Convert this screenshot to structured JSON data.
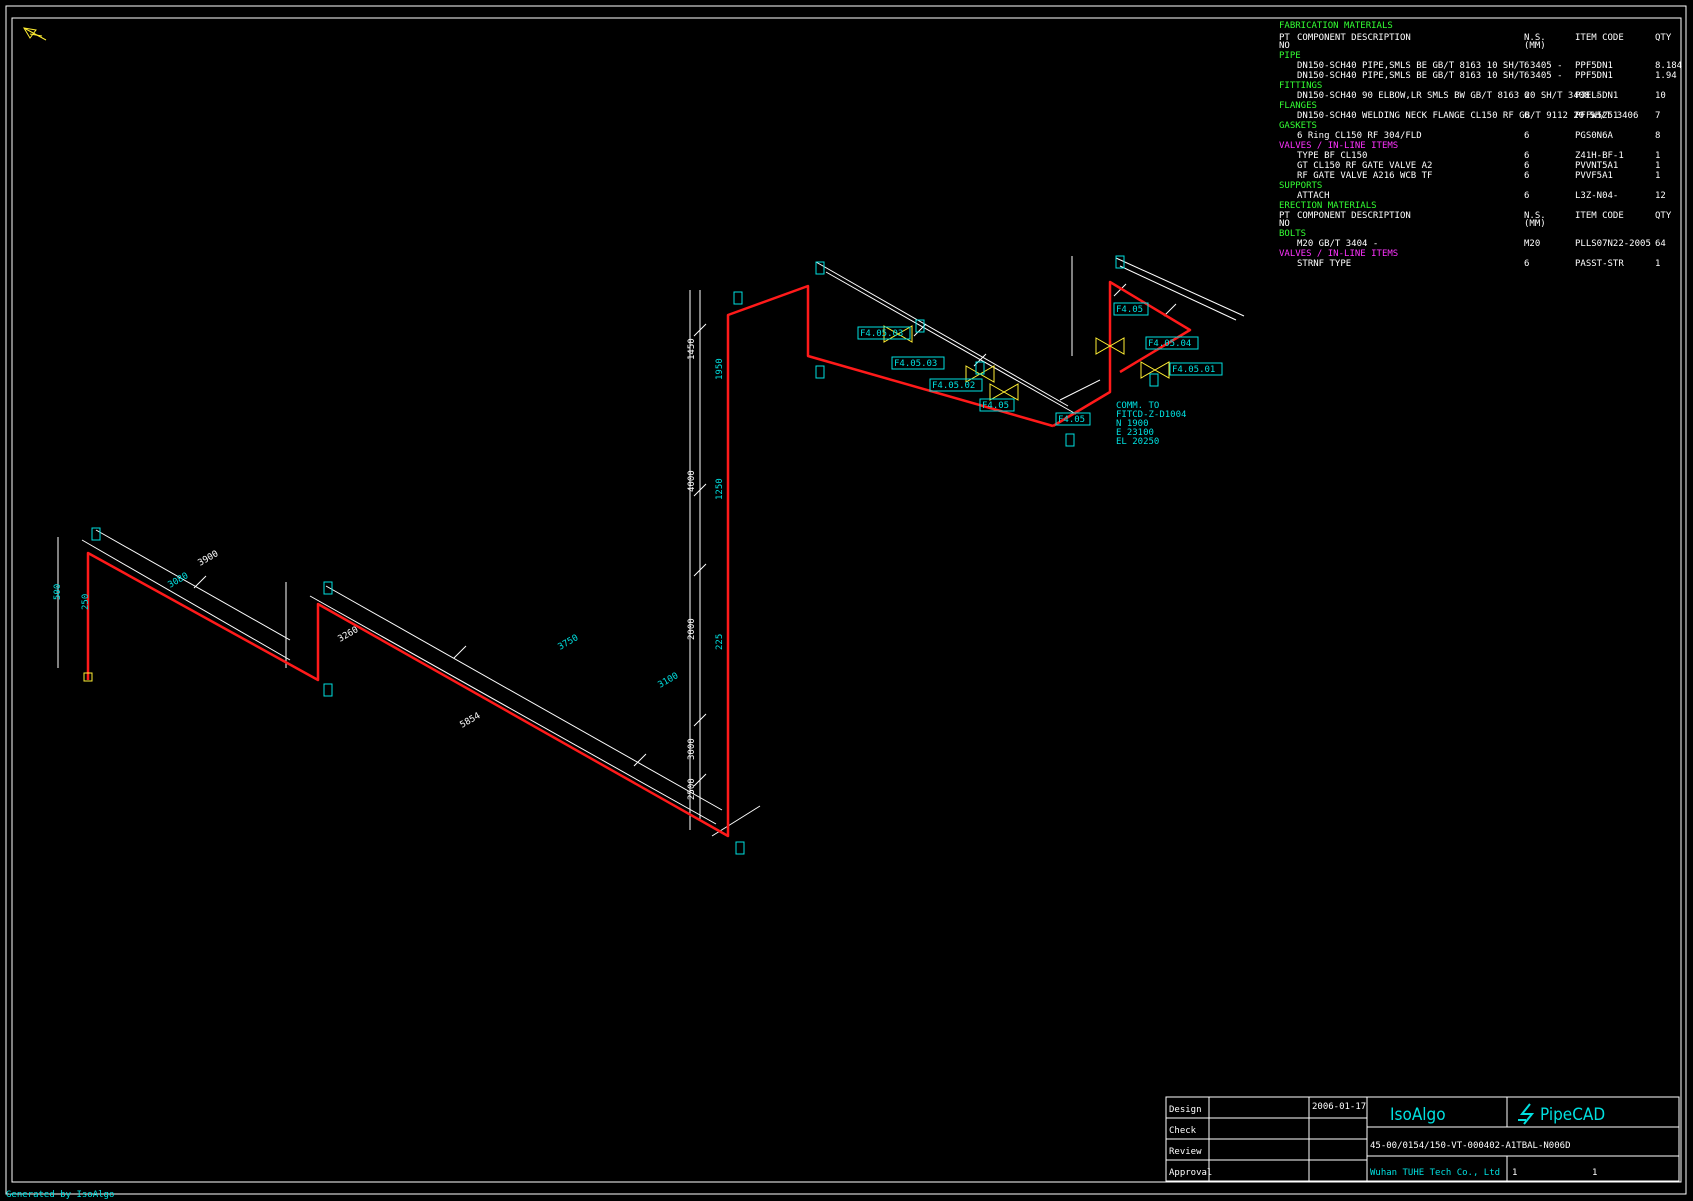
{
  "colors": {
    "background": "#000000",
    "pipe": "#ff1a1a",
    "line": "#ffffff",
    "accent": "#00e0e0",
    "valve": "#ffee33",
    "heading_green": "#33ff33",
    "heading_magenta": "#ff33ff"
  },
  "icons": {
    "north_arrow": "north-arrow-icon",
    "logo": "pipecad-logo-icon"
  },
  "bom": {
    "title": "FABRICATION MATERIALS",
    "header": {
      "pt": "PT",
      "no": "NO",
      "desc": "COMPONENT DESCRIPTION",
      "nps": "N.S.",
      "nps_unit": "(MM)",
      "code": "ITEM CODE",
      "qty": "QTY"
    },
    "rows": [
      {
        "heading": "PIPE"
      },
      {
        "desc": "DN150-SCH40 PIPE,SMLS BE GB/T 8163 10 SH/T 3405 -",
        "nps": "6",
        "code": "PPF5DN1",
        "qty": "8.184"
      },
      {
        "desc": "DN150-SCH40 PIPE,SMLS BE GB/T 8163 10 SH/T 3405 -",
        "nps": "6",
        "code": "PPF5DN1",
        "qty": "1.94"
      },
      {
        "heading": "FITTINGS"
      },
      {
        "desc": "DN150-SCH40 90 ELBOW,LR SMLS BW GB/T 8163 20 SH/T 3408 -",
        "nps": "6",
        "code": "PJEL5DN1",
        "qty": "10"
      },
      {
        "heading": "FLANGES"
      },
      {
        "desc": "DN150-SCH40 WELDING NECK FLANGE CL150 RF GB/T 9112 20 SH/T 3406",
        "nps": "6",
        "code": "PFFW5251",
        "qty": "7"
      },
      {
        "heading": "GASKETS"
      },
      {
        "desc": "6 Ring CL150 RF 304/FLD",
        "nps": "6",
        "code": "PGS0N6A",
        "qty": "8"
      },
      {
        "heading_alt": "VALVES / IN-LINE ITEMS"
      },
      {
        "desc": "TYPE BF CL150",
        "nps": "6",
        "code": "Z41H-BF-1",
        "qty": "1"
      },
      {
        "desc": "GT CL150 RF GATE VALVE A2",
        "nps": "6",
        "code": "PVVNT5A1",
        "qty": "1"
      },
      {
        "desc": "RF GATE VALVE A216 WCB TF",
        "nps": "6",
        "code": "PVVF5A1",
        "qty": "1"
      },
      {
        "heading": "SUPPORTS"
      },
      {
        "desc": "ATTACH",
        "nps": "6",
        "code": "L3Z-N04-",
        "qty": "12"
      },
      {
        "heading": "ERECTION MATERIALS"
      },
      {
        "header_repeat": true
      },
      {
        "heading": "BOLTS"
      },
      {
        "desc": "M20 GB/T 3404 -",
        "nps": "M20",
        "code": "PLLS07N22-2005",
        "qty": "64"
      },
      {
        "heading_alt": "VALVES / IN-LINE ITEMS"
      },
      {
        "desc": "STRNF TYPE",
        "nps": "6",
        "code": "PASST-STR",
        "qty": "1"
      }
    ]
  },
  "titleblock": {
    "rows": [
      "Design",
      "Check",
      "Review",
      "Approval"
    ],
    "date": "2006-01-17",
    "software": "IsoAlgo",
    "brand": "PipeCAD",
    "drawing_no": "45-00/0154/150-VT-000402-A1TBAL-N006D",
    "company": "Wuhan TUHE Tech Co., Ltd",
    "sheet": "1",
    "of": "1"
  },
  "footer": "Generated by IsoAlgo",
  "annotations": {
    "comm_lines": [
      "COMM. TO",
      "FITCD-Z-D1004",
      "N 1900",
      "E 23100",
      "EL 20250"
    ],
    "dims_run1": [
      "3900",
      "3750",
      "3260"
    ],
    "dims_run2": [
      "3100",
      "5854",
      "3080",
      "1250"
    ],
    "dims_vertical": [
      "1450",
      "4000",
      "2000",
      "3000",
      "2500",
      "1950",
      "1250",
      "225",
      "500",
      "250"
    ],
    "tags": [
      "F4.05.03",
      "F4.05.03",
      "F4.05.02",
      "F4.05",
      "F4.05",
      "F4.05.04",
      "F4.05.01",
      "F4.05"
    ]
  }
}
